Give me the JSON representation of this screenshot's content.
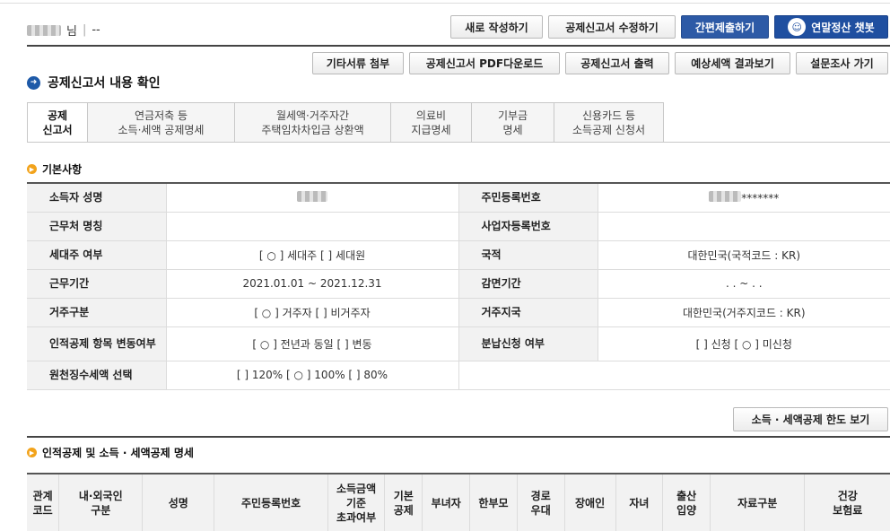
{
  "user": {
    "suffix": "님",
    "separator": "|",
    "value": "--"
  },
  "top_buttons": [
    "새로 작성하기",
    "공제신고서 수정하기",
    "간편제출하기",
    "연말정산 챗봇"
  ],
  "action_buttons": [
    "기타서류 첨부",
    "공제신고서 PDF다운로드",
    "공제신고서 출력",
    "예상세액 결과보기",
    "설문조사 가기"
  ],
  "section_title": "공제신고서 내용 확인",
  "tabs": [
    "공제\n신고서",
    "연금저축 등\n소득·세액 공제명세",
    "월세액·거주자간\n주택임차차입금 상환액",
    "의료비\n지급명세",
    "기부금\n명세",
    "신용카드 등\n소득공제 신청서"
  ],
  "basic": {
    "title": "기본사항",
    "rows": [
      {
        "l1": "소득자 성명",
        "v1": "",
        "l2": "주민등록번호",
        "v2": "*******"
      },
      {
        "l1": "근무처 명칭",
        "v1": "",
        "l2": "사업자등록번호",
        "v2": ""
      },
      {
        "l1": "세대주 여부",
        "v1": "[ ○ ] 세대주  [    ] 세대원",
        "l2": "국적",
        "v2": "대한민국(국적코드 : KR)"
      },
      {
        "l1": "근무기간",
        "v1": "2021.01.01 ~ 2021.12.31",
        "l2": "감면기간",
        "v2": ". . ~ . ."
      },
      {
        "l1": "거주구분",
        "v1": "[ ○ ] 거주자  [    ] 비거주자",
        "l2": "거주지국",
        "v2": "대한민국(거주지코드 : KR)"
      },
      {
        "l1": "인적공제 항목 변동여부",
        "v1": "[ ○ ] 전년과 동일  [    ] 변동",
        "l2": "분납신청 여부",
        "v2": "[    ] 신청 [ ○ ] 미신청"
      },
      {
        "l1": "원천징수세액 선택",
        "v1": "[    ] 120%  [ ○ ] 100% [    ] 80%",
        "l2": "",
        "v2": ""
      }
    ]
  },
  "limit_button": "소득 · 세액공제 한도 보기",
  "deduction": {
    "title": "인적공제 및 소득 · 세액공제 명세",
    "headers": [
      "관계\n코드",
      "내·외국인\n구분",
      "성명",
      "주민등록번호",
      "소득금액\n기준\n초과여부",
      "기본\n공제",
      "부녀자",
      "한부모",
      "경로\n우대",
      "장애인",
      "자녀",
      "출산\n입양",
      "자료구분",
      "건강\n보험료"
    ]
  }
}
